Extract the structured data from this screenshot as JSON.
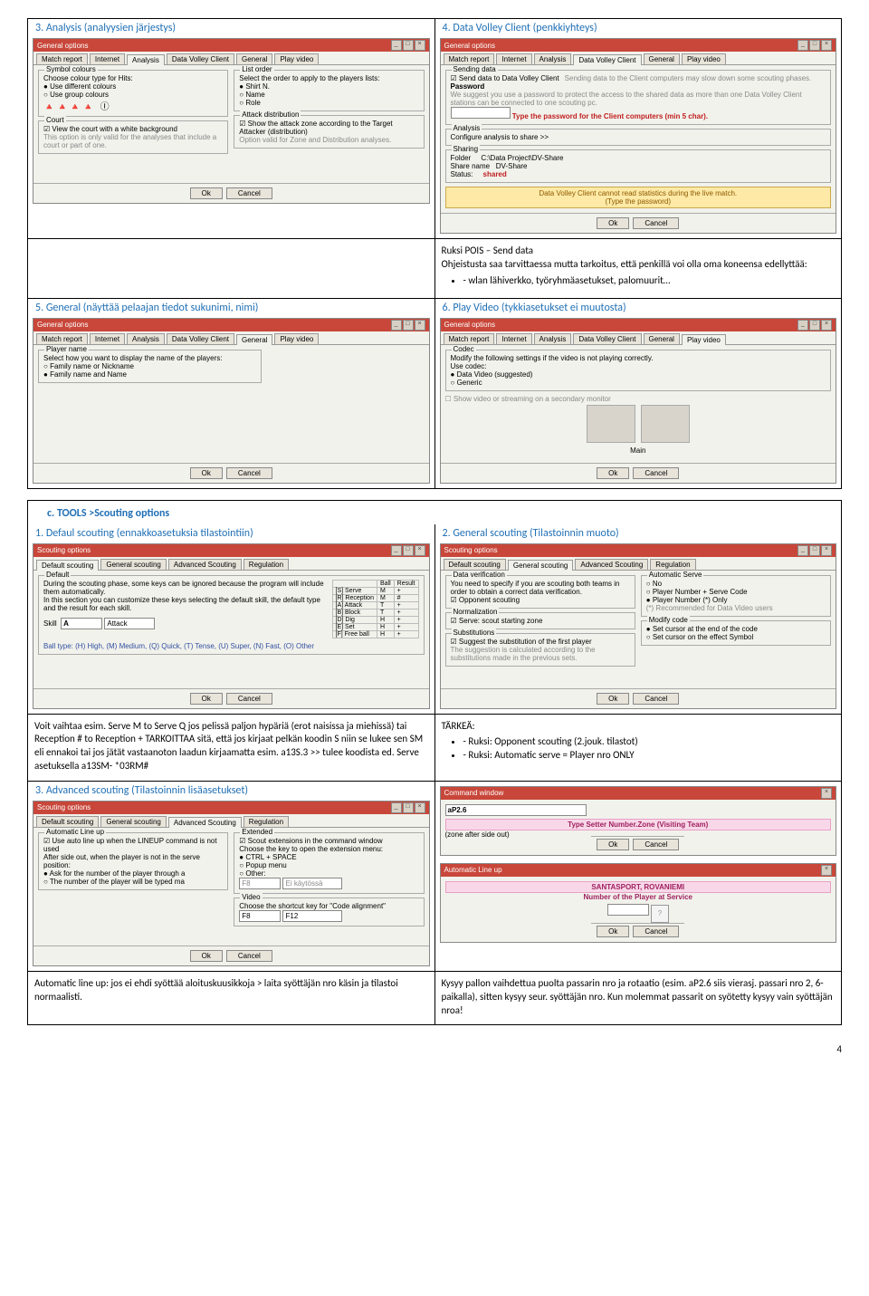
{
  "sections": {
    "s3": "3.   Analysis    (analyysien järjestys)",
    "s4": "4.   Data Volley Client    (penkkiyhteys)",
    "s5": "5.   General    (näyttää pelaajan tiedot sukunimi, nimi)",
    "s6": "6.   Play Video    (tykkiasetukset  ei muutosta)",
    "sc": "c.   TOOLS >Scouting options",
    "sc1": "1.   Defaul scouting    (ennakkoasetuksia tilastointiin)",
    "sc2": "2.   General scouting    (Tilastoinnin muoto)",
    "sc3": "3.   Advanced scouting     (Tilastoinnin lisäasetukset)"
  },
  "win": {
    "general_options": "General options",
    "scouting_options": "Scouting options",
    "command_window": "Command window",
    "auto_lineup": "Automatic Line up",
    "ok": "Ok",
    "cancel": "Cancel"
  },
  "tabsGO": {
    "t1": "Match report",
    "t2": "Internet",
    "t3": "Analysis",
    "t4": "Data Volley Client",
    "t5": "General",
    "t6": "Play video"
  },
  "tabsSC": {
    "t1": "Default scouting",
    "t2": "General scouting",
    "t3": "Advanced Scouting",
    "t4": "Regulation"
  },
  "w3": {
    "sym": "Symbol colours",
    "choose": "Choose colour type for Hits:",
    "r1": "Use different colours",
    "r2": "Use group colours",
    "court": "Court",
    "viewcourt": "View the court with a white background",
    "note1": "This option is only valid for the analyses that include a court or part of one.",
    "list": "List order",
    "listsub": "Select the order to apply to the players lists:",
    "lo1": "Shirt N.",
    "lo2": "Name",
    "lo3": "Role",
    "att": "Attack distribution",
    "attck": "Show the attack zone according to the Target Attacker (distribution)",
    "note2": "Option valid for Zone and Distribution analyses."
  },
  "w4": {
    "send": "Sending data",
    "sendck": "Send data to Data Volley Client",
    "sendnote": "Sending data to the Client computers may slow down some scouting phases.",
    "pwd": "Password",
    "pwdnote": "We suggest you use a password to protect the access to the shared data as more than one Data Volley Client stations can be connected to one scouting pc.",
    "pwdred": "Type the password for the Client computers (min 5 char).",
    "an": "Analysis",
    "ancfg": "Configure analysis to share >>",
    "sh": "Sharing",
    "folder": "Folder",
    "folderv": "C:\\Data Project\\DV-Share",
    "shname": "Share name",
    "shnamev": "DV-Share",
    "status": "Status:",
    "statusv": "shared",
    "warn1": "Data Volley Client cannot read statistics during the live match.",
    "warn2": "(Type the password)"
  },
  "wRuksi": {
    "title": "Ruksi POIS – Send data",
    "line": "Ohjeistusta saa tarvittaessa mutta tarkoitus, että penkillä voi olla oma koneensa edellyttää:",
    "bul": "wlan lähiverkko, työryhmäasetukset, palomuurit…"
  },
  "w5": {
    "pn": "Player name",
    "sel": "Select how you want to display the name of the players:",
    "r1": "Family name or Nickname",
    "r2": "Family name and Name"
  },
  "w6": {
    "codec": "Codec",
    "mod": "Modify the following settings if the video is not playing correctly.",
    "use": "Use codec:",
    "r1": "Data Video (suggested)",
    "r2": "Generic",
    "showsec": "Show video or streaming on a secondary monitor",
    "main": "Main"
  },
  "wDS": {
    "def": "Default",
    "p1": "During the scouting phase, some keys can be ignored because the program will include them automatically.",
    "p2": "In this section you can customize these keys selecting the default skill, the default type and the result for each skill.",
    "skill": "Skill",
    "attack": "Attack",
    "ball": "Ball",
    "result": "Result",
    "r1": "[S] Serve",
    "r2": "[R] Reception",
    "r3": "[A] Attack",
    "r4": "[B] Block",
    "r5": "[D] Dig",
    "r6": "[E] Set",
    "r7": "[F] Free ball",
    "v1m": "M",
    "v1p": "+",
    "v2m": "M",
    "v2h": "#",
    "v3t": "T",
    "v3p": "+",
    "v4t": "T",
    "v4p": "+",
    "v5h": "H",
    "v5p": "+",
    "v6h": "H",
    "v6p": "+",
    "v7h": "H",
    "v7p": "+",
    "legend": "Ball type: (H) High, (M) Medium, (Q) Quick, (T) Tense, (U) Super, (N) Fast, (O) Other"
  },
  "wGS": {
    "dv": "Data verification",
    "dvtxt": "You need to specify if you are scouting both teams in order to obtain a correct data verification.",
    "opp": "Opponent scouting",
    "norm": "Normalization",
    "sz": "Serve: scout starting zone",
    "subs": "Substitutions",
    "sug": "Suggest the substitution of the first player",
    "sugnote": "The suggestion is calculated according to the substitutions made in the previous sets.",
    "as": "Automatic Serve",
    "as1": "No",
    "as2": "Player Number + Serve Code",
    "as3": "Player Number (*) Only",
    "asnote": "(*) Recommended for Data Video users",
    "mc": "Modify code",
    "mc1": "Set cursor at the end of the code",
    "mc2": "Set cursor on the effect Symbol"
  },
  "wNotes1": "Voit vaihtaa esim. Serve M to Serve Q jos pelissä paljon hypäriä (erot naisissa ja miehissä) tai Reception # to Reception +   TARKOITTAA sitä, että jos kirjaat pelkän koodin S niin se lukee sen SM eli ennakoi tai jos jätät vastaanoton laadun kirjaamatta esim. a13S.3 >> tulee koodista ed. Serve asetuksella a13SM- *03RM#",
  "wNotes2": {
    "t": "TÄRKEÄ:",
    "b1": "Ruksi: Opponent scouting (2.jouk. tilastot)",
    "b2": "Ruksi: Automatic serve = Player nro ONLY"
  },
  "wAS": {
    "alu": "Automatic Line up",
    "aluck": "Use auto line up when the LINEUP command is not used",
    "after": "After side out, when the player is not in the serve position:",
    "r1": "Ask for the number of the player through a",
    "r2": "The number of the player will be typed ma",
    "ext": "Extended",
    "extck": "Scout extensions in the command window",
    "chk": "Choose the key to open the extension menu:",
    "c1": "CTRL + SPACE",
    "c2": "Popup menu",
    "c3": "Other:",
    "eik": "Ei käytössä",
    "vid": "Video",
    "vidtxt": "Choose the shortcut key for \"Code alignment\"",
    "f12": "F12"
  },
  "wCmd": {
    "code": "aP2.6",
    "pink": "Type Setter Number.Zone (Visiting Team)",
    "zone": "(zone after side out)",
    "santa": "SANTASPORT, ROVANIEMI",
    "numsv": "Number of the Player at Service"
  },
  "wBottom1": "Automatic line up: jos ei ehdi syöttää aloituskuusikkoja > laita syöttäjän nro käsin ja tilastoi normaalisti.",
  "wBottom2": "Kysyy pallon vaihdettua puolta passarin nro ja rotaatio (esim. aP2.6 siis vierasj. passari nro 2, 6-paikalla), sitten kysyy seur. syöttäjän nro. Kun molemmat passarit on syötetty kysyy vain syöttäjän nroa!",
  "page": "4"
}
